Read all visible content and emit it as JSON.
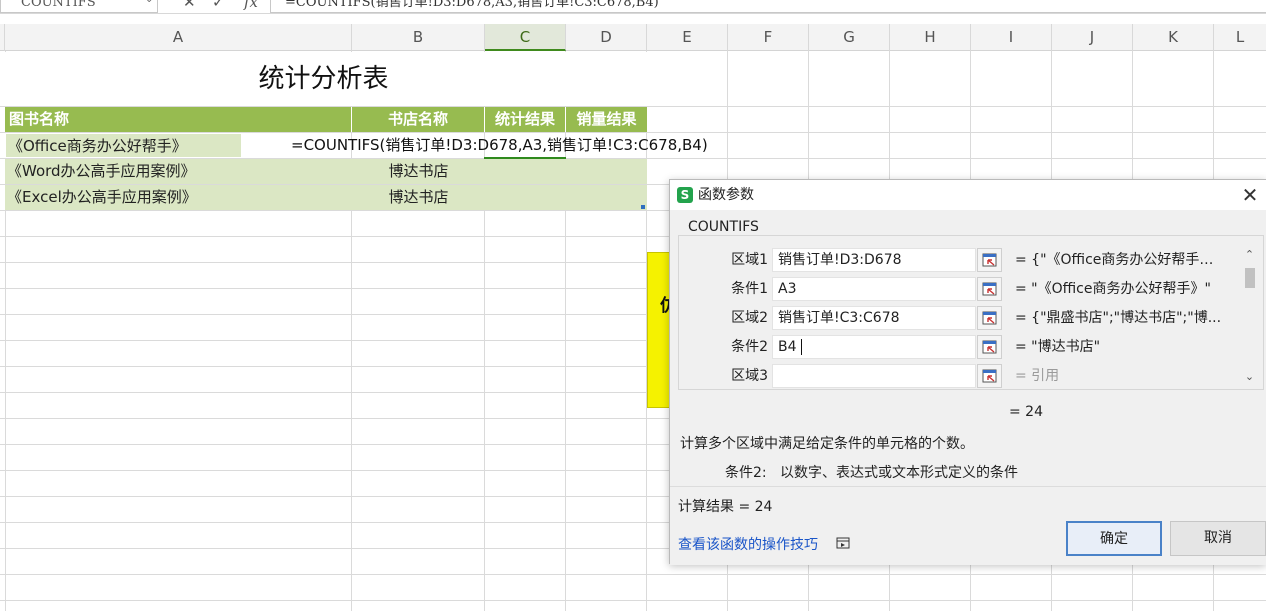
{
  "formula_bar": {
    "name_box": "COUNTIFS",
    "cancel_icon": "close-icon",
    "confirm_icon": "check-icon",
    "fx_label": "fx",
    "formula": "=COUNTIFS(销售订单!D3:D678,A3,销售订单!C3:C678,B4)"
  },
  "columns": [
    "A",
    "B",
    "C",
    "D",
    "E",
    "F",
    "G",
    "H",
    "I",
    "J",
    "K",
    "L"
  ],
  "selected_column": "C",
  "sheet": {
    "title": "统计分析表",
    "headers": [
      "图书名称",
      "书店名称",
      "统计结果",
      "销量结果"
    ],
    "rows": [
      {
        "book": "《Office商务办公好帮手》",
        "store": ""
      },
      {
        "book": "《Word办公高手应用案例》",
        "store": "博达书店"
      },
      {
        "book": "《Excel办公高手应用案例》",
        "store": "博达书店"
      }
    ],
    "editing_formula": "=COUNTIFS(销售订单!D3:D678,A3,销售订单!C3:C678,B4)",
    "shape_text": "仿"
  },
  "dialog": {
    "logo": "S",
    "title": "函数参数",
    "function_name": "COUNTIFS",
    "args": [
      {
        "label": "区域1",
        "value": "销售订单!D3:D678",
        "result": "= {\"《Office商务办公好帮手》\"..."
      },
      {
        "label": "条件1",
        "value": "A3",
        "result": "= \"《Office商务办公好帮手》\""
      },
      {
        "label": "区域2",
        "value": "销售订单!C3:C678",
        "result": "= {\"鼎盛书店\";\"博达书店\";\"博..."
      },
      {
        "label": "条件2",
        "value": "B4",
        "result": "= \"博达书店\""
      },
      {
        "label": "区域3",
        "value": "",
        "result": "= 引用"
      }
    ],
    "formula_result": "= 24",
    "description": "计算多个区域中满足给定条件的单元格的个数。",
    "arg_desc_label": "条件2:",
    "arg_desc": "以数字、表达式或文本形式定义的条件",
    "calc_result": "计算结果 = 24",
    "help_link": "查看该函数的操作技巧",
    "ok": "确定",
    "cancel": "取消"
  }
}
